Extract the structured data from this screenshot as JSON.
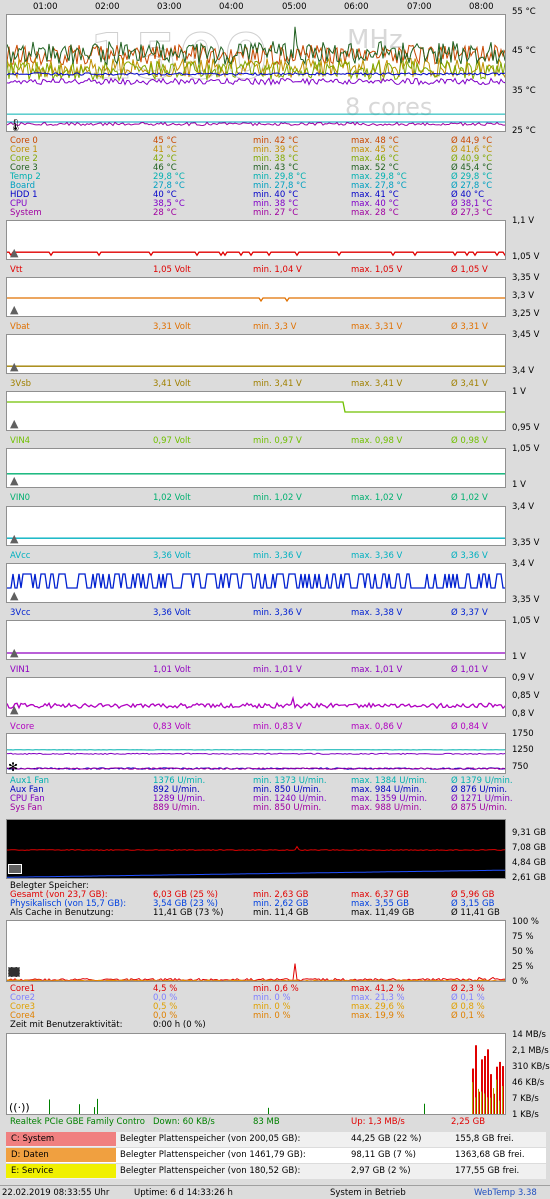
{
  "colors": {
    "core0": "#c84800",
    "core1": "#c09000",
    "core2": "#80a800",
    "core3": "#206020",
    "temp2": "#00b0b0",
    "board": "#00a0c0",
    "hdd1": "#0000c8",
    "cpu": "#8000c8",
    "system": "#a000a0",
    "vtt": "#e00000",
    "vbat": "#e07000",
    "v3vsb": "#a08000",
    "vin4": "#70c000",
    "vin0": "#00b070",
    "avcc": "#00b0c0",
    "v3vcc": "#0020d0",
    "vin1": "#9000c0",
    "vcore": "#b000c0",
    "aux1fan": "#00b0b0",
    "auxfan": "#0000c0",
    "cpufan": "#8000c0",
    "sysfan": "#a000a0",
    "ram_total": "#e00000",
    "ram_phys": "#0040e0",
    "ram_cache": "#000000",
    "cpu1": "#e00000",
    "cpu2": "#8080ff",
    "cpu3": "#e0a000",
    "cpu4": "#e08000",
    "net": "#008000",
    "up": "#e00000"
  },
  "time_axis": [
    "01:00",
    "02:00",
    "03:00",
    "04:00",
    "05:00",
    "06:00",
    "07:00",
    "08:00"
  ],
  "temp": {
    "watermark": "1500",
    "watermark_unit": "MHz",
    "watermark_cores": "8 cores",
    "ylabels": [
      "55 °C",
      "45 °C",
      "35 °C",
      "25 °C"
    ],
    "rows": [
      {
        "name": "Core 0",
        "cur": "45 °C",
        "min": "min. 42 °C",
        "max": "max. 48 °C",
        "avg": "Ø 44,9 °C",
        "key": "core0"
      },
      {
        "name": "Core 1",
        "cur": "41 °C",
        "min": "min. 39 °C",
        "max": "max. 45 °C",
        "avg": "Ø 41,6 °C",
        "key": "core1"
      },
      {
        "name": "Core 2",
        "cur": "42 °C",
        "min": "min. 38 °C",
        "max": "max. 46 °C",
        "avg": "Ø 40,9 °C",
        "key": "core2"
      },
      {
        "name": "Core 3",
        "cur": "46 °C",
        "min": "min. 43 °C",
        "max": "max. 52 °C",
        "avg": "Ø 45,4 °C",
        "key": "core3"
      },
      {
        "name": "Temp 2",
        "cur": "29,8 °C",
        "min": "min. 29,8 °C",
        "max": "max. 29,8 °C",
        "avg": "Ø 29,8 °C",
        "key": "temp2"
      },
      {
        "name": "Board",
        "cur": "27,8 °C",
        "min": "min. 27,8 °C",
        "max": "max. 27,8 °C",
        "avg": "Ø 27,8 °C",
        "key": "board"
      },
      {
        "name": "HDD 1",
        "cur": "40 °C",
        "min": "min. 40 °C",
        "max": "max. 41 °C",
        "avg": "Ø 40 °C",
        "key": "hdd1"
      },
      {
        "name": "CPU",
        "cur": "38,5 °C",
        "min": "min. 38 °C",
        "max": "max. 40 °C",
        "avg": "Ø 38,1 °C",
        "key": "cpu"
      },
      {
        "name": "System",
        "cur": "28 °C",
        "min": "min. 27 °C",
        "max": "max. 28 °C",
        "avg": "Ø 27,3 °C",
        "key": "system"
      }
    ]
  },
  "volts": [
    {
      "name": "Vtt",
      "cur": "1,05 Volt",
      "min": "min. 1,04 V",
      "max": "max. 1,05 V",
      "avg": "Ø 1,05 V",
      "top": "1,1 V",
      "bot": "1,05 V",
      "key": "vtt",
      "level": 0.78
    },
    {
      "name": "Vbat",
      "cur": "3,31 Volt",
      "min": "min. 3,3 V",
      "max": "max. 3,31 V",
      "avg": "Ø 3,31 V",
      "top": "3,35 V",
      "bot": "3,25 V",
      "key": "vbat",
      "level": 0.5,
      "mid": "3,3 V"
    },
    {
      "name": "3Vsb",
      "cur": "3,41 Volt",
      "min": "min. 3,41 V",
      "max": "max. 3,41 V",
      "avg": "Ø 3,41 V",
      "top": "3,45 V",
      "bot": "3,4 V",
      "key": "v3vsb",
      "level": 0.78
    },
    {
      "name": "VIN4",
      "cur": "0,97 Volt",
      "min": "min. 0,97 V",
      "max": "max. 0,98 V",
      "avg": "Ø 0,98 V",
      "top": "1 V",
      "bot": "0,95 V",
      "key": "vin4",
      "level": 0.5
    },
    {
      "name": "VIN0",
      "cur": "1,02 Volt",
      "min": "min. 1,02 V",
      "max": "max. 1,02 V",
      "avg": "Ø 1,02 V",
      "top": "1,05 V",
      "bot": "1 V",
      "key": "vin0",
      "level": 0.62
    },
    {
      "name": "AVcc",
      "cur": "3,36 Volt",
      "min": "min. 3,36 V",
      "max": "max. 3,36 V",
      "avg": "Ø 3,36 V",
      "top": "3,4 V",
      "bot": "3,35 V",
      "key": "avcc",
      "level": 0.78
    },
    {
      "name": "3Vcc",
      "cur": "3,36 Volt",
      "min": "min. 3,36 V",
      "max": "max. 3,38 V",
      "avg": "Ø 3,37 V",
      "top": "3,4 V",
      "bot": "3,35 V",
      "key": "v3vcc",
      "level": 0.5
    },
    {
      "name": "VIN1",
      "cur": "1,01 Volt",
      "min": "min. 1,01 V",
      "max": "max. 1,01 V",
      "avg": "Ø 1,01 V",
      "top": "1,05 V",
      "bot": "1 V",
      "key": "vin1",
      "level": 0.8
    },
    {
      "name": "Vcore",
      "cur": "0,83 Volt",
      "min": "min. 0,83 V",
      "max": "max. 0,86 V",
      "avg": "Ø 0,84 V",
      "top": "0,9 V",
      "bot": "0,8 V",
      "key": "vcore",
      "level": 0.68,
      "mid": "0,85 V"
    }
  ],
  "fans": {
    "ylabels": [
      "1750",
      "1250",
      "750"
    ],
    "rows": [
      {
        "name": "Aux1 Fan",
        "cur": "1376 U/min.",
        "min": "min. 1373 U/min.",
        "max": "max. 1384 U/min.",
        "avg": "Ø 1379 U/min.",
        "key": "aux1fan"
      },
      {
        "name": "Aux Fan",
        "cur": "892 U/min.",
        "min": "min. 850 U/min.",
        "max": "max. 984 U/min.",
        "avg": "Ø 876 U/min.",
        "key": "auxfan"
      },
      {
        "name": "CPU Fan",
        "cur": "1289 U/min.",
        "min": "min. 1240 U/min.",
        "max": "max. 1359 U/min.",
        "avg": "Ø 1271 U/min.",
        "key": "cpufan"
      },
      {
        "name": "Sys Fan",
        "cur": "889 U/min.",
        "min": "min. 850 U/min.",
        "max": "max. 988 U/min.",
        "avg": "Ø 875 U/min.",
        "key": "sysfan"
      }
    ]
  },
  "ram": {
    "ylabels": [
      "9,31 GB",
      "7,08 GB",
      "4,84 GB",
      "2,61 GB"
    ],
    "header": "Belegter Speicher:",
    "rows": [
      {
        "name": "Gesamt (von 23,7 GB):",
        "cur": "6,03 GB (25 %)",
        "min": "min. 2,63 GB",
        "max": "max. 6,37 GB",
        "avg": "Ø 5,96 GB",
        "key": "ram_total"
      },
      {
        "name": "Physikalisch (von 15,7 GB):",
        "cur": "3,54 GB (23 %)",
        "min": "min. 2,62 GB",
        "max": "max. 3,55 GB",
        "avg": "Ø 3,15 GB",
        "key": "ram_phys"
      },
      {
        "name": "Als Cache in Benutzung:",
        "cur": "11,41 GB (73 %)",
        "min": "min. 11,4 GB",
        "max": "max. 11,49 GB",
        "avg": "Ø 11,41 GB",
        "key": "ram_cache"
      }
    ]
  },
  "cpuload": {
    "ylabels": [
      "100 %",
      "75 %",
      "50 %",
      "25 %",
      "0 %"
    ],
    "rows": [
      {
        "name": "Core1",
        "cur": "4,5 %",
        "min": "min. 0,6 %",
        "max": "max. 41,2 %",
        "avg": "Ø 2,3 %",
        "key": "cpu1"
      },
      {
        "name": "Core2",
        "cur": "0,0 %",
        "min": "min. 0 %",
        "max": "max. 21,3 %",
        "avg": "Ø 0,1 %",
        "key": "cpu2"
      },
      {
        "name": "Core3",
        "cur": "0,5 %",
        "min": "min. 0 %",
        "max": "max. 29,6 %",
        "avg": "Ø 0,8 %",
        "key": "cpu3"
      },
      {
        "name": "Core4",
        "cur": "0,0 %",
        "min": "min. 0 %",
        "max": "max. 19,9 %",
        "avg": "Ø 0,1 %",
        "key": "cpu4"
      }
    ],
    "activity_label": "Zeit mit Benutzeraktivität:",
    "activity_value": "0:00 h (0 %)"
  },
  "network": {
    "ylabels": [
      "14 MB/s",
      "2,1 MB/s",
      "310 KB/s",
      "46 KB/s",
      "7 KB/s",
      "1 KB/s"
    ],
    "adapter": "Realtek PCIe GBE Family Contro",
    "down": "Down: 60 KB/s",
    "down_total": "83 MB",
    "up": "Up: 1,3 MB/s",
    "up_total": "2,25 GB"
  },
  "drives": [
    {
      "tag": "C: System",
      "desc": "Belegter Plattenspeicher (von 200,05 GB):",
      "used": "44,25 GB (22 %)",
      "free": "155,8 GB frei.",
      "color": "#f08080"
    },
    {
      "tag": "D: Daten",
      "desc": "Belegter Plattenspeicher (von 1461,79 GB):",
      "used": "98,11 GB (7 %)",
      "free": "1363,68 GB frei.",
      "color": "#f0a040"
    },
    {
      "tag": "E: Service",
      "desc": "Belegter Plattenspeicher (von 180,52 GB):",
      "used": "2,97 GB (2 %)",
      "free": "177,55 GB frei.",
      "color": "#f0f000"
    }
  ],
  "status": {
    "datetime": "22.02.2019 08:33:55 Uhr",
    "uptime": "Uptime: 6 d 14:33:26 h",
    "state": "System in Betrieb",
    "app": "WebTemp 3.38"
  }
}
